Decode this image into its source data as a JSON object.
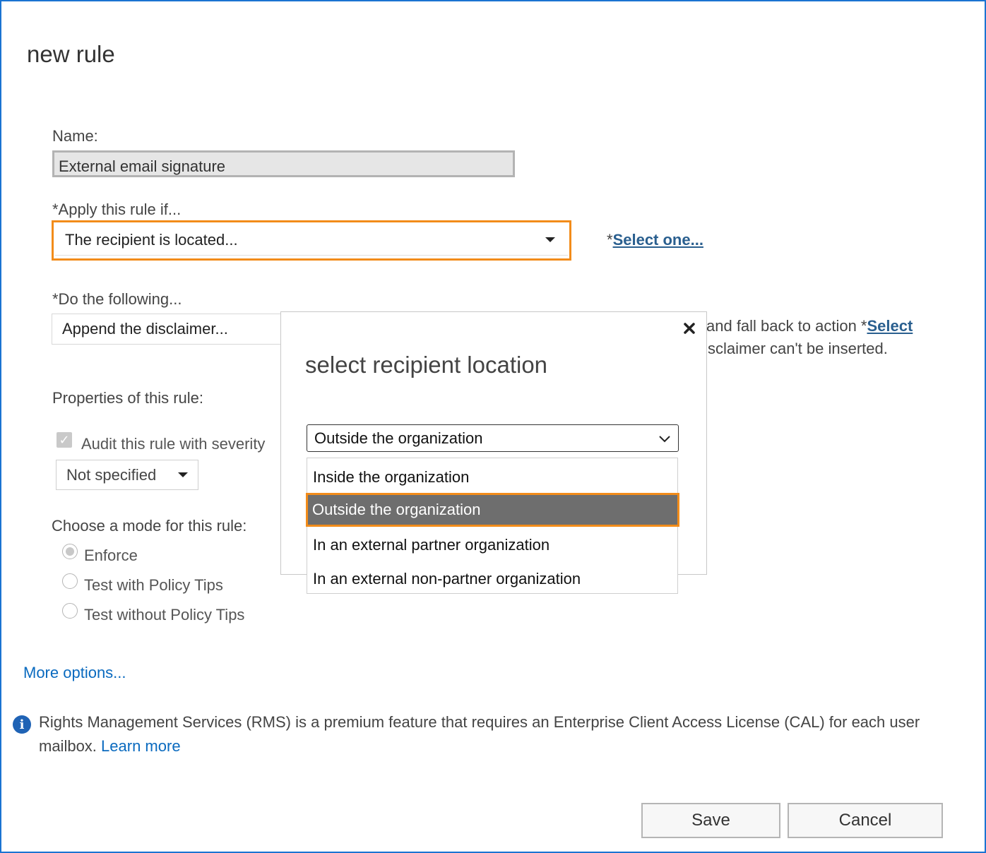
{
  "page": {
    "title": "new rule"
  },
  "form": {
    "name_label": "Name:",
    "name_value": "External email signature",
    "apply_label": "*Apply this rule if...",
    "apply_value": "The recipient is located...",
    "apply_required_marker": "*",
    "apply_link": "Select one...",
    "do_label": "*Do the following...",
    "do_value": "Append the disclaimer...",
    "do_side_text_1": "and fall back to action ",
    "do_side_marker": "*",
    "do_side_link": "Select",
    "do_side_text_2": "sclaimer can't be inserted.",
    "properties_label": "Properties of this rule:",
    "audit_label": "Audit this rule with severity",
    "audit_checked": true,
    "severity_value": "Not specified",
    "mode_label": "Choose a mode for this rule:",
    "modes": [
      {
        "label": "Enforce",
        "selected": true
      },
      {
        "label": "Test with Policy Tips",
        "selected": false
      },
      {
        "label": "Test without Policy Tips",
        "selected": false
      }
    ],
    "more_options": "More options..."
  },
  "info": {
    "text_1": "Rights Management Services (RMS) is a premium feature that requires an Enterprise Client Access License (CAL) for each user",
    "text_2": "mailbox.",
    "link": "Learn more"
  },
  "buttons": {
    "save": "Save",
    "cancel": "Cancel"
  },
  "modal": {
    "title": "select recipient location",
    "close_icon": "close-icon",
    "selected_value": "Outside the organization",
    "options": [
      {
        "label": "Inside the organization",
        "highlighted": false
      },
      {
        "label": "Outside the organization",
        "highlighted": true
      },
      {
        "label": "In an external partner organization",
        "highlighted": false
      },
      {
        "label": "In an external non-partner organization",
        "highlighted": false
      }
    ]
  },
  "colors": {
    "accent_border": "#1a73d1",
    "highlight": "#f28c1a",
    "link": "#0a6abf",
    "selected_item_bg": "#6e6e6e"
  }
}
